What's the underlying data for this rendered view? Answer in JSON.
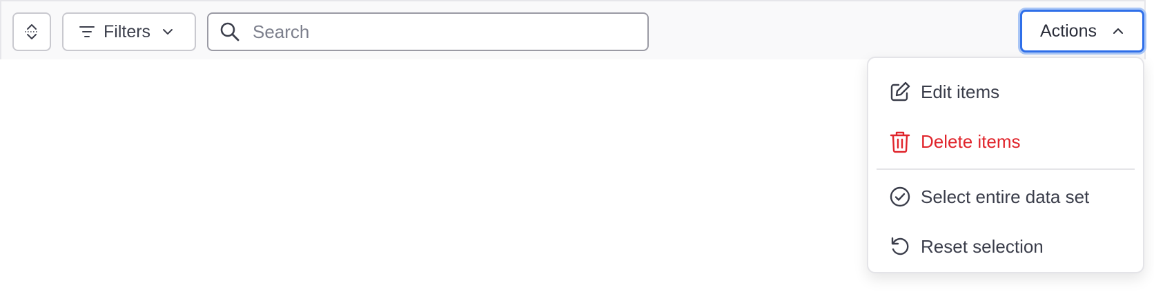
{
  "toolbar": {
    "sort_icon": "sort-icon",
    "filters": {
      "label": "Filters",
      "icon": "filter-icon",
      "chevron": "chevron-down-icon"
    },
    "search": {
      "placeholder": "Search",
      "value": "",
      "icon": "search-icon"
    },
    "actions": {
      "label": "Actions",
      "chevron": "chevron-up-icon",
      "focus_color": "#2f6fe9"
    }
  },
  "actions_menu": {
    "items": [
      {
        "label": "Edit items",
        "icon": "edit-icon"
      },
      {
        "label": "Delete items",
        "icon": "trash-icon",
        "color": "#e0242b"
      },
      {
        "label": "Select entire data set",
        "icon": "check-circle-icon"
      },
      {
        "label": "Reset selection",
        "icon": "reset-icon"
      }
    ]
  }
}
